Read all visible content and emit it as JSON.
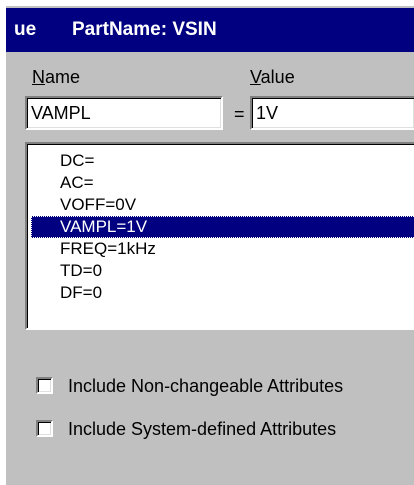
{
  "window": {
    "title_prefix": "ue",
    "title": "PartName: VSIN"
  },
  "labels": {
    "name": "Name",
    "value": "Value",
    "equals": "="
  },
  "fields": {
    "name_value": "VAMPL",
    "value_value": "1V"
  },
  "attributes": {
    "items": [
      "DC=",
      "AC=",
      "VOFF=0V",
      "VAMPL=1V",
      "FREQ=1kHz",
      "TD=0",
      "DF=0"
    ],
    "selected_index": 3
  },
  "options": {
    "include_non_changeable": {
      "label": "Include Non-changeable Attributes",
      "checked": false
    },
    "include_system_defined": {
      "label": "Include System-defined Attributes",
      "checked": false
    }
  },
  "colors": {
    "title_bar": "#000080",
    "selection": "#000080",
    "face": "#c0c0c0"
  }
}
